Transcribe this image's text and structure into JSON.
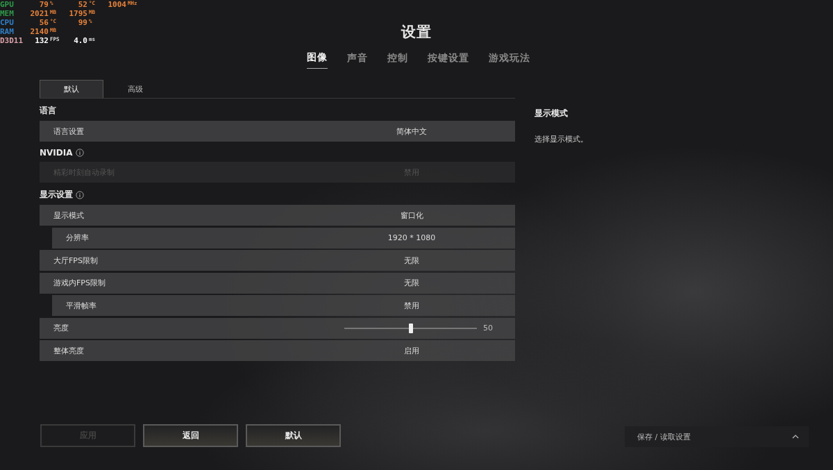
{
  "overlay": [
    {
      "label": "GPU",
      "color": "#2e9a4a",
      "values": [
        {
          "value": "79",
          "unit": "%"
        },
        {
          "value": "52",
          "unit": "°C"
        },
        {
          "value": "1004",
          "unit": "MHz"
        }
      ]
    },
    {
      "label": "MEM",
      "color": "#2e9a4a",
      "values": [
        {
          "value": "2021",
          "unit": "MB"
        },
        {
          "value": "1795",
          "unit": "MB"
        }
      ]
    },
    {
      "label": "CPU",
      "color": "#2f7fc8",
      "values": [
        {
          "value": "56",
          "unit": "°C"
        },
        {
          "value": "99",
          "unit": "%"
        }
      ]
    },
    {
      "label": "RAM",
      "color": "#2f7fc8",
      "values": [
        {
          "value": "2140",
          "unit": "MB"
        }
      ]
    },
    {
      "label": "D3D11",
      "color": "#d9a0a8",
      "values": [
        {
          "value": "132",
          "unit": "FPS"
        },
        {
          "value": "4.0",
          "unit": "ms"
        }
      ]
    }
  ],
  "title": "设置",
  "tabs": [
    {
      "label": "图像",
      "selected": true
    },
    {
      "label": "声音",
      "selected": false
    },
    {
      "label": "控制",
      "selected": false
    },
    {
      "label": "按键设置",
      "selected": false
    },
    {
      "label": "游戏玩法",
      "selected": false
    }
  ],
  "subtabs": [
    {
      "label": "默认",
      "selected": true
    },
    {
      "label": "高级",
      "selected": false
    }
  ],
  "sections": [
    {
      "title": "语言",
      "info": false,
      "rows": [
        {
          "kind": "select",
          "label": "语言设置",
          "value": "简体中文",
          "indent": false,
          "disabled": false
        }
      ]
    },
    {
      "title": "NVIDIA",
      "info": true,
      "rows": [
        {
          "kind": "select",
          "label": "精彩时刻自动录制",
          "value": "禁用",
          "indent": false,
          "disabled": true
        }
      ]
    },
    {
      "title": "显示设置",
      "info": true,
      "rows": [
        {
          "kind": "select",
          "label": "显示模式",
          "value": "窗口化",
          "indent": false,
          "disabled": false
        },
        {
          "kind": "select",
          "label": "分辨率",
          "value": "1920 * 1080",
          "indent": true,
          "disabled": false
        },
        {
          "kind": "select",
          "label": "大厅FPS限制",
          "value": "无限",
          "indent": false,
          "disabled": false
        },
        {
          "kind": "select",
          "label": "游戏内FPS限制",
          "value": "无限",
          "indent": false,
          "disabled": false
        },
        {
          "kind": "select",
          "label": "平滑帧率",
          "value": "禁用",
          "indent": true,
          "disabled": false
        },
        {
          "kind": "slider",
          "label": "亮度",
          "value": "50",
          "level": 0.5,
          "indent": false,
          "disabled": false
        },
        {
          "kind": "select",
          "label": "整体亮度",
          "value": "启用",
          "indent": false,
          "disabled": false
        }
      ]
    }
  ],
  "help": {
    "title": "显示模式",
    "text": "选择显示模式。"
  },
  "buttons": [
    {
      "label": "应用",
      "disabled": true
    },
    {
      "label": "返回",
      "disabled": false
    },
    {
      "label": "默认",
      "disabled": false
    }
  ],
  "save_button": {
    "label": "保存 / 读取设置"
  }
}
